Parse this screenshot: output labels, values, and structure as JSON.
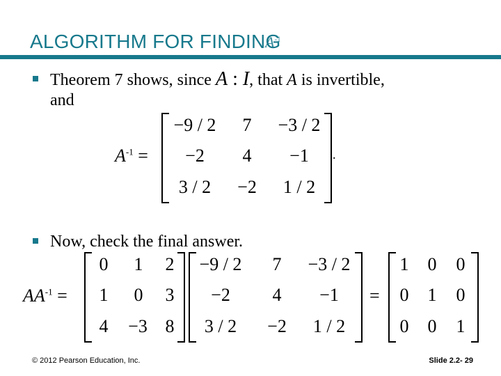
{
  "slide": {
    "title": "ALGORITHM FOR FINDING",
    "title_overlap": {
      "base": "A",
      "sup": "-1"
    },
    "accent_color": "#17798c"
  },
  "bullets": [
    {
      "line1_prefix": "Theorem 7 shows, since ",
      "line1_math_A": "A",
      "line1_math_sep": " : ",
      "line1_math_I": "I",
      "line1_suffix_1": ", that ",
      "line1_suffix_A": "A",
      "line1_suffix_2": " is invertible,",
      "line2": "and"
    },
    {
      "text": "Now, check the final answer."
    }
  ],
  "equation1": {
    "lhs_base": "A",
    "lhs_sup": "-1",
    "equals": "=",
    "matrix": [
      [
        "−9 / 2",
        "7",
        "−3 / 2"
      ],
      [
        "−2",
        "4",
        "−1"
      ],
      [
        "3 / 2",
        "−2",
        "1 / 2"
      ]
    ],
    "trailing": "."
  },
  "equation2": {
    "lhs": "AA",
    "lhs_sup": "-1",
    "equals1": "=",
    "matrix_a": [
      [
        "0",
        "1",
        "2"
      ],
      [
        "1",
        "0",
        "3"
      ],
      [
        "4",
        "−3",
        "8"
      ]
    ],
    "matrix_b": [
      [
        "−9 / 2",
        "7",
        "−3 / 2"
      ],
      [
        "−2",
        "4",
        "−1"
      ],
      [
        "3 / 2",
        "−2",
        "1 / 2"
      ]
    ],
    "equals2": "=",
    "matrix_c": [
      [
        "1",
        "0",
        "0"
      ],
      [
        "0",
        "1",
        "0"
      ],
      [
        "0",
        "0",
        "1"
      ]
    ]
  },
  "footer": {
    "copyright": "© 2012 Pearson Education, Inc.",
    "slide_number": "Slide 2.2- 29"
  }
}
